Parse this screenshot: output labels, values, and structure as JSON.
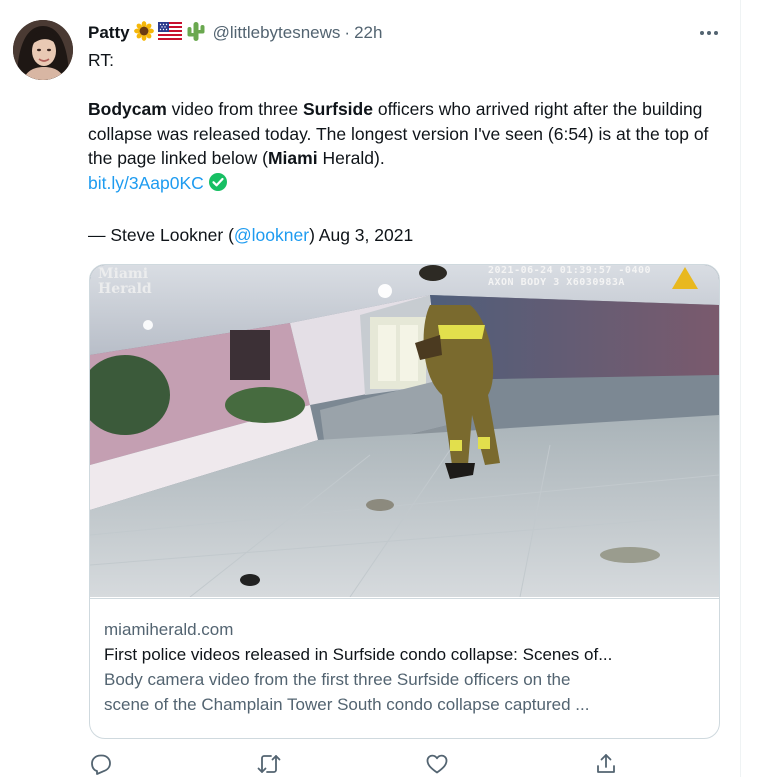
{
  "tweet": {
    "display_name": "Patty",
    "emojis": [
      "sunflower-emoji",
      "us-flag-emoji",
      "cactus-emoji"
    ],
    "handle": "@littlebytesnews",
    "separator": "·",
    "time": "22h",
    "more_icon": "more-horizontal-icon",
    "rt_label": "RT:",
    "body": {
      "w1": "Bodycam",
      "t1": " video from three ",
      "w2": "Surfside",
      "t2": " officers who arrived right after the building collapse was released today. The longest version I've seen (6:54) is at the top of the page linked below (",
      "w3": "Miami",
      "t3": " Herald).",
      "link": "bit.ly/3Aap0KC",
      "link_icon": "check-circle-icon"
    },
    "attribution": {
      "prefix": "— Steve Lookner (",
      "mention": "@lookner",
      "suffix": ") Aug 3, 2021"
    }
  },
  "card": {
    "image_watermark": [
      "Miami",
      "Herald"
    ],
    "image_stamp": [
      "2021-06-24 01:39:57 -0400",
      "AXON BODY 3 X6030983A"
    ],
    "domain": "miamiherald.com",
    "title": "First police videos released in Surfside condo collapse: Scenes of...",
    "description_line1": "Body camera video from the first three Surfside officers on the",
    "description_line2": "scene of the Champlain Tower South condo collapse captured ..."
  },
  "actions": [
    {
      "name": "reply-button",
      "icon": "reply-icon"
    },
    {
      "name": "retweet-button",
      "icon": "retweet-icon"
    },
    {
      "name": "like-button",
      "icon": "heart-icon"
    },
    {
      "name": "share-button",
      "icon": "share-icon"
    }
  ],
  "colors": {
    "link": "#1d9bf0",
    "secondary_text": "#536471",
    "primary_text": "#0f1419",
    "border": "#cfd9de",
    "verified_green": "#17bf63"
  }
}
